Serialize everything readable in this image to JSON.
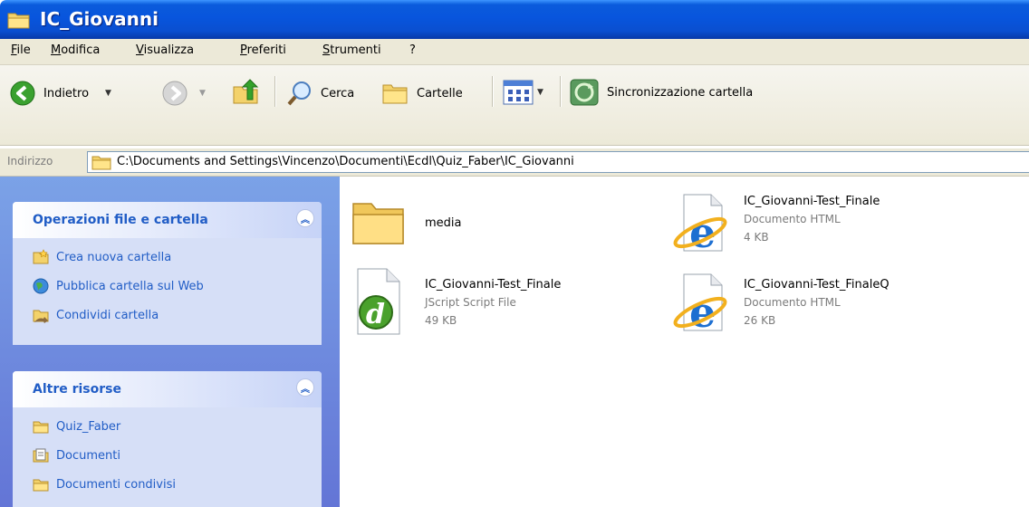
{
  "window": {
    "title": "IC_Giovanni"
  },
  "menu": [
    "File",
    "Modifica",
    "Visualizza",
    "Preferiti",
    "Strumenti",
    "?"
  ],
  "toolbar": {
    "back_label": "Indietro",
    "search_label": "Cerca",
    "folders_label": "Cartelle",
    "sync_label": "Sincronizzazione cartella"
  },
  "address": {
    "label": "Indirizzo",
    "path": "C:\\Documents and Settings\\Vincenzo\\Documenti\\Ecdl\\Quiz_Faber\\IC_Giovanni"
  },
  "taskpane": {
    "file_ops": {
      "title": "Operazioni file e cartella",
      "items": [
        "Crea nuova cartella",
        "Pubblica cartella sul Web",
        "Condividi cartella"
      ]
    },
    "other": {
      "title": "Altre risorse",
      "items": [
        "Quiz_Faber",
        "Documenti",
        "Documenti condivisi"
      ]
    }
  },
  "files": [
    {
      "name": "media",
      "type": "",
      "size": ""
    },
    {
      "name": "IC_Giovanni-Test_Finale",
      "type": "Documento HTML",
      "size": "4 KB"
    },
    {
      "name": "IC_Giovanni-Test_Finale",
      "type": "JScript Script File",
      "size": "49 KB"
    },
    {
      "name": "IC_Giovanni-Test_FinaleQ",
      "type": "Documento HTML",
      "size": "26 KB"
    }
  ],
  "colors": {
    "titlebar": "#0855dd",
    "taskpane_bg": "#6f8fe0",
    "link": "#215dc6",
    "chrome": "#ece9d8"
  }
}
